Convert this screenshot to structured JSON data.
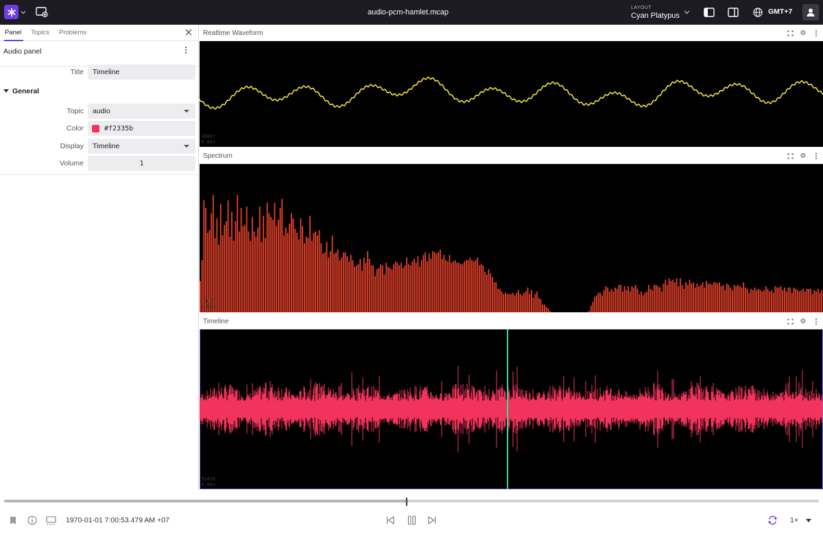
{
  "app": {
    "file_name": "audio-pcm-hamlet.mcap",
    "layout_label": "LAYOUT",
    "layout_name": "Cyan Platypus",
    "timezone": "GMT+7"
  },
  "sidebar": {
    "tabs": [
      "Panel",
      "Topics",
      "Problems"
    ],
    "panel_title": "Audio panel",
    "fields": {
      "title": {
        "label": "Title",
        "value": "Timeline"
      },
      "section": "General",
      "topic": {
        "label": "Topic",
        "value": "audio"
      },
      "color": {
        "label": "Color",
        "value": "#f2335b"
      },
      "display": {
        "label": "Display",
        "value": "Timeline"
      },
      "volume": {
        "label": "Volume",
        "value": "1"
      }
    }
  },
  "panels": {
    "waveform": {
      "title": "Realtime Waveform",
      "stat1": "38887",
      "stat2": "0.0ms",
      "line_color": "#f0e040"
    },
    "spectrum": {
      "title": "Spectrum",
      "stat1": "43467",
      "stat2": "0.0ms",
      "bar_color": "#e8412a",
      "bar_levels": [
        0.24,
        0.4,
        0.86,
        0.8,
        0.61,
        0.63,
        0.76,
        0.9,
        0.57,
        0.72,
        0.52,
        0.83,
        0.59,
        0.67,
        0.7,
        0.86,
        0.58,
        0.77,
        0.55,
        0.7,
        0.9,
        0.62,
        0.8,
        0.66,
        0.67,
        0.81,
        0.62,
        0.55,
        0.73,
        0.62,
        0.58,
        0.65,
        0.81,
        0.54,
        0.74,
        0.57,
        0.84,
        0.76,
        0.73,
        0.71,
        0.84,
        0.66,
        0.71,
        0.8,
        0.87,
        0.59,
        0.65,
        0.61,
        0.68,
        0.76,
        0.72,
        0.64,
        0.61,
        0.56,
        0.72,
        0.66,
        0.53,
        0.58,
        0.57,
        0.74,
        0.55,
        0.61,
        0.62,
        0.59,
        0.63,
        0.53,
        0.45,
        0.46,
        0.54,
        0.42,
        0.47,
        0.59,
        0.45,
        0.46,
        0.48,
        0.4,
        0.42,
        0.46,
        0.46,
        0.43,
        0.39,
        0.44,
        0.4,
        0.35,
        0.36,
        0.37,
        0.41,
        0.32,
        0.42,
        0.38,
        0.47,
        0.41,
        0.36,
        0.36,
        0.28,
        0.33,
        0.34,
        0.37,
        0.36,
        0.29,
        0.38,
        0.35,
        0.34,
        0.33,
        0.37,
        0.39,
        0.38,
        0.36,
        0.38,
        0.34,
        0.36,
        0.42,
        0.37,
        0.36,
        0.39,
        0.41,
        0.38,
        0.43,
        0.35,
        0.4,
        0.44,
        0.46,
        0.39,
        0.45,
        0.41,
        0.47,
        0.46,
        0.45,
        0.46,
        0.48,
        0.41,
        0.44,
        0.4,
        0.39,
        0.44,
        0.38,
        0.39,
        0.4,
        0.38,
        0.38,
        0.37,
        0.37,
        0.39,
        0.4,
        0.4,
        0.42,
        0.4,
        0.39,
        0.4,
        0.42,
        0.36,
        0.37,
        0.36,
        0.31,
        0.29,
        0.33,
        0.3,
        0.27,
        0.23,
        0.23,
        0.18,
        0.18,
        0.16,
        0.14,
        0.15,
        0.14,
        0.14,
        0.14,
        0.15,
        0.13,
        0.15,
        0.17,
        0.14,
        0.13,
        0.15,
        0.16,
        0.19,
        0.14,
        0.17,
        0.11,
        0.14,
        0.16,
        0.11,
        0.1,
        0.06,
        0.06,
        0.04,
        0.03,
        0.01,
        0,
        0,
        0,
        0,
        0,
        0,
        0,
        0,
        0,
        0,
        0,
        0,
        0,
        0,
        0,
        0,
        0,
        0,
        0,
        0,
        0.01,
        0.05,
        0.08,
        0.12,
        0.13,
        0.15,
        0.15,
        0.13,
        0.17,
        0.2,
        0.19,
        0.16,
        0.18,
        0.16,
        0.19,
        0.18,
        0.21,
        0.21,
        0.16,
        0.2,
        0.17,
        0.2,
        0.16,
        0.2,
        0.19,
        0.21,
        0.18,
        0.14,
        0.16,
        0.13,
        0.15,
        0.16,
        0.21,
        0.18,
        0.17,
        0.21,
        0.21,
        0.2,
        0.19,
        0.16,
        0.22,
        0.25,
        0.21,
        0.26,
        0.24,
        0.25,
        0.23,
        0.26,
        0.2,
        0.26,
        0.21,
        0.18,
        0.23,
        0.21,
        0.25,
        0.22,
        0.23,
        0.19,
        0.22,
        0.2,
        0.21,
        0.23,
        0.19,
        0.24,
        0.22,
        0.22,
        0.21,
        0.23,
        0.23,
        0.22,
        0.23,
        0.2,
        0.21,
        0.17,
        0.22,
        0.21,
        0.19,
        0.17,
        0.21,
        0.2,
        0.21,
        0.2,
        0.19,
        0.23,
        0.19,
        0.18,
        0.15,
        0.18,
        0.17,
        0.19,
        0.17,
        0.18,
        0.17,
        0.16,
        0.17,
        0.2,
        0.18,
        0.16,
        0.17,
        0.15,
        0.2,
        0.19,
        0.19,
        0.2,
        0.17,
        0.19,
        0.16,
        0.19,
        0.19,
        0.15,
        0.19,
        0.18,
        0.17,
        0.16,
        0.17,
        0.18,
        0.16,
        0.18,
        0.18,
        0.18,
        0.14,
        0.17,
        0.16,
        0.18,
        0.15,
        0.17
      ]
    },
    "timeline": {
      "title": "Timeline",
      "stat1": "91438",
      "stat2": "0.0ms",
      "wave_color": "#f2335b",
      "cursor_color": "#3ed8a4"
    }
  },
  "playback": {
    "time": "1970-01-01 7:00:53.479 AM +07",
    "speed": "1×",
    "progress": 0.494
  }
}
